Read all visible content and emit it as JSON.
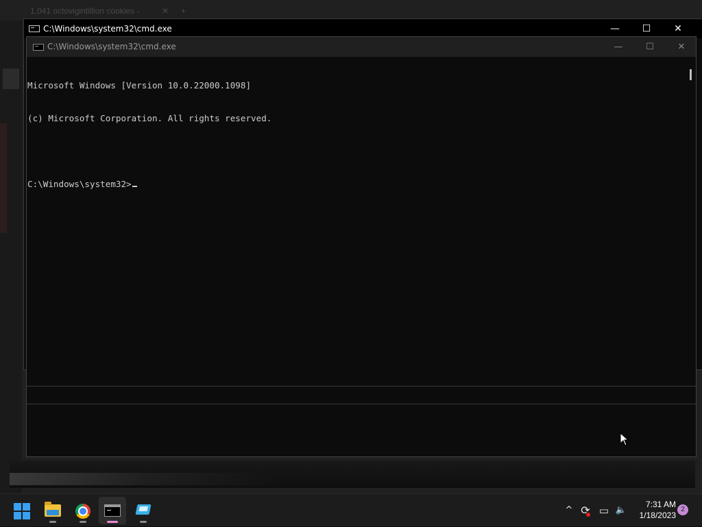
{
  "background_window": {
    "tab_title": "1,041 octovigintillion cookies -",
    "tab_close_glyph": "✕",
    "new_tab_glyph": "+"
  },
  "outer_window": {
    "title": "C:\\Windows\\system32\\cmd.exe",
    "controls": {
      "minimize": "—",
      "maximize": "☐",
      "close": "✕"
    }
  },
  "inner_window": {
    "title": "C:\\Windows\\system32\\cmd.exe",
    "controls": {
      "minimize": "—",
      "maximize": "☐",
      "close": "✕"
    },
    "console_lines": [
      "Microsoft Windows [Version 10.0.22000.1098]",
      "(c) Microsoft Corporation. All rights reserved.",
      "",
      "C:\\Windows\\system32>"
    ]
  },
  "taskbar": {
    "apps": [
      {
        "name": "start",
        "icon": "windows-logo-icon"
      },
      {
        "name": "file-explorer",
        "icon": "folder-icon",
        "running": true
      },
      {
        "name": "chrome",
        "icon": "chrome-icon",
        "running": true
      },
      {
        "name": "command-prompt",
        "icon": "cmd-icon",
        "running": true,
        "active": true
      },
      {
        "name": "snipping-tool",
        "icon": "screenshot-icon",
        "running": true
      }
    ],
    "tray": {
      "chevron_glyph": "^",
      "sync_glyph": "⟳",
      "network_glyph": "▭",
      "volume_glyph": "🔈",
      "time": "7:31 AM",
      "date": "1/18/2023",
      "notification_count": "2"
    }
  },
  "colors": {
    "console_bg": "#0c0c0c",
    "console_text": "#cccccc",
    "taskbar_bg": "#1c1c1c",
    "active_indicator": "#e98ad3"
  }
}
